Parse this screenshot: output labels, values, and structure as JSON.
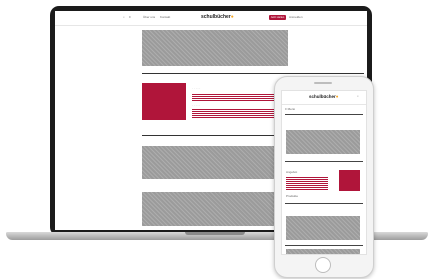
{
  "laptop": {
    "nav": {
      "link1": "Über uns",
      "link2": "Kontakt",
      "cta": "Jetzt starten",
      "account": "Anmelden"
    },
    "logo": "schulbücher"
  },
  "phone": {
    "logo": "schulbücher",
    "menu": "≡ Menü",
    "section1_label": "Angebot",
    "section2_label": "Produkte"
  },
  "colors": {
    "accent": "#b0153a",
    "placeholder": "#9b9b9b",
    "logo_dot": "#f5a623"
  }
}
